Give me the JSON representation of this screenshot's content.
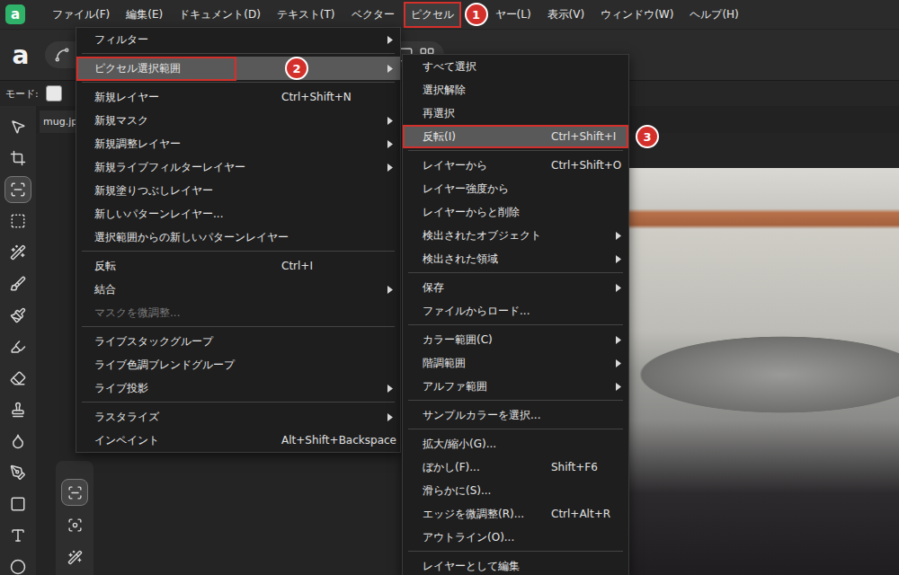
{
  "window": {
    "logo": "a"
  },
  "menubar": [
    {
      "label": "ファイル(F)",
      "selected": false,
      "annotated": false,
      "badge": ""
    },
    {
      "label": "編集(E)",
      "selected": false,
      "annotated": false,
      "badge": ""
    },
    {
      "label": "ドキュメント(D)",
      "selected": false,
      "annotated": false,
      "badge": ""
    },
    {
      "label": "テキスト(T)",
      "selected": false,
      "annotated": false,
      "badge": ""
    },
    {
      "label": "ベクター",
      "selected": false,
      "annotated": false,
      "badge": ""
    },
    {
      "label": "ピクセル",
      "selected": true,
      "annotated": true,
      "badge": "1"
    },
    {
      "label": "ヤー(L)",
      "selected": false,
      "annotated": false,
      "badge": ""
    },
    {
      "label": "表示(V)",
      "selected": false,
      "annotated": false,
      "badge": ""
    },
    {
      "label": "ウィンドウ(W)",
      "selected": false,
      "annotated": false,
      "badge": ""
    },
    {
      "label": "ヘルプ(H)",
      "selected": false,
      "annotated": false,
      "badge": ""
    }
  ],
  "mode_bar": {
    "label": "モード:",
    "checked": false
  },
  "document_tab": {
    "label": "mug.jp"
  },
  "tools": [
    {
      "selected": false
    },
    {
      "selected": false
    },
    {
      "selected": true
    },
    {
      "selected": false
    },
    {
      "selected": false
    },
    {
      "selected": false
    },
    {
      "selected": false
    },
    {
      "selected": false
    },
    {
      "selected": false
    },
    {
      "selected": false
    },
    {
      "selected": false
    },
    {
      "selected": false
    },
    {
      "selected": false
    },
    {
      "selected": false
    },
    {
      "selected": false
    }
  ],
  "floating_tools": [
    {
      "selected": true
    },
    {
      "selected": false
    },
    {
      "selected": false
    }
  ],
  "pixel_menu": [
    {
      "kind": "item",
      "label": "フィルター",
      "shortcut": "",
      "submenu": true,
      "selected": false,
      "disabled": false,
      "annotated": false,
      "badge": ""
    },
    {
      "kind": "separator"
    },
    {
      "kind": "item",
      "label": "ピクセル選択範囲",
      "shortcut": "",
      "submenu": true,
      "selected": true,
      "disabled": false,
      "annotated": true,
      "badge": "2"
    },
    {
      "kind": "separator"
    },
    {
      "kind": "item",
      "label": "新規レイヤー",
      "shortcut": "Ctrl+Shift+N",
      "submenu": false,
      "selected": false,
      "disabled": false,
      "annotated": false,
      "badge": ""
    },
    {
      "kind": "item",
      "label": "新規マスク",
      "shortcut": "",
      "submenu": true,
      "selected": false,
      "disabled": false,
      "annotated": false,
      "badge": ""
    },
    {
      "kind": "item",
      "label": "新規調整レイヤー",
      "shortcut": "",
      "submenu": true,
      "selected": false,
      "disabled": false,
      "annotated": false,
      "badge": ""
    },
    {
      "kind": "item",
      "label": "新規ライブフィルターレイヤー",
      "shortcut": "",
      "submenu": true,
      "selected": false,
      "disabled": false,
      "annotated": false,
      "badge": ""
    },
    {
      "kind": "item",
      "label": "新規塗りつぶしレイヤー",
      "shortcut": "",
      "submenu": false,
      "selected": false,
      "disabled": false,
      "annotated": false,
      "badge": ""
    },
    {
      "kind": "item",
      "label": "新しいパターンレイヤー...",
      "shortcut": "",
      "submenu": false,
      "selected": false,
      "disabled": false,
      "annotated": false,
      "badge": ""
    },
    {
      "kind": "item",
      "label": "選択範囲からの新しいパターンレイヤー",
      "shortcut": "",
      "submenu": false,
      "selected": false,
      "disabled": false,
      "annotated": false,
      "badge": ""
    },
    {
      "kind": "separator"
    },
    {
      "kind": "item",
      "label": "反転",
      "shortcut": "Ctrl+I",
      "submenu": false,
      "selected": false,
      "disabled": false,
      "annotated": false,
      "badge": ""
    },
    {
      "kind": "item",
      "label": "結合",
      "shortcut": "",
      "submenu": true,
      "selected": false,
      "disabled": false,
      "annotated": false,
      "badge": ""
    },
    {
      "kind": "item",
      "label": "マスクを微調整...",
      "shortcut": "",
      "submenu": false,
      "selected": false,
      "disabled": true,
      "annotated": false,
      "badge": ""
    },
    {
      "kind": "separator"
    },
    {
      "kind": "item",
      "label": "ライブスタックグループ",
      "shortcut": "",
      "submenu": false,
      "selected": false,
      "disabled": false,
      "annotated": false,
      "badge": ""
    },
    {
      "kind": "item",
      "label": "ライブ色調ブレンドグループ",
      "shortcut": "",
      "submenu": false,
      "selected": false,
      "disabled": false,
      "annotated": false,
      "badge": ""
    },
    {
      "kind": "item",
      "label": "ライブ投影",
      "shortcut": "",
      "submenu": true,
      "selected": false,
      "disabled": false,
      "annotated": false,
      "badge": ""
    },
    {
      "kind": "separator"
    },
    {
      "kind": "item",
      "label": "ラスタライズ",
      "shortcut": "",
      "submenu": true,
      "selected": false,
      "disabled": false,
      "annotated": false,
      "badge": ""
    },
    {
      "kind": "item",
      "label": "インペイント",
      "shortcut": "Alt+Shift+Backspace",
      "submenu": false,
      "selected": false,
      "disabled": false,
      "annotated": false,
      "badge": ""
    }
  ],
  "selection_submenu": [
    {
      "kind": "item",
      "label": "すべて選択",
      "shortcut": "",
      "submenu": false,
      "selected": false,
      "disabled": false,
      "annotated": false,
      "badge": ""
    },
    {
      "kind": "item",
      "label": "選択解除",
      "shortcut": "",
      "submenu": false,
      "selected": false,
      "disabled": false,
      "annotated": false,
      "badge": ""
    },
    {
      "kind": "item",
      "label": "再選択",
      "shortcut": "",
      "submenu": false,
      "selected": false,
      "disabled": false,
      "annotated": false,
      "badge": ""
    },
    {
      "kind": "item",
      "label": "反転(I)",
      "shortcut": "Ctrl+Shift+I",
      "submenu": false,
      "selected": true,
      "disabled": false,
      "annotated": true,
      "badge": "3"
    },
    {
      "kind": "separator"
    },
    {
      "kind": "item",
      "label": "レイヤーから",
      "shortcut": "Ctrl+Shift+O",
      "submenu": false,
      "selected": false,
      "disabled": false,
      "annotated": false,
      "badge": ""
    },
    {
      "kind": "item",
      "label": "レイヤー強度から",
      "shortcut": "",
      "submenu": false,
      "selected": false,
      "disabled": false,
      "annotated": false,
      "badge": ""
    },
    {
      "kind": "item",
      "label": "レイヤーからと削除",
      "shortcut": "",
      "submenu": false,
      "selected": false,
      "disabled": false,
      "annotated": false,
      "badge": ""
    },
    {
      "kind": "item",
      "label": "検出されたオブジェクト",
      "shortcut": "",
      "submenu": true,
      "selected": false,
      "disabled": false,
      "annotated": false,
      "badge": ""
    },
    {
      "kind": "item",
      "label": "検出された領域",
      "shortcut": "",
      "submenu": true,
      "selected": false,
      "disabled": false,
      "annotated": false,
      "badge": ""
    },
    {
      "kind": "separator"
    },
    {
      "kind": "item",
      "label": "保存",
      "shortcut": "",
      "submenu": true,
      "selected": false,
      "disabled": false,
      "annotated": false,
      "badge": ""
    },
    {
      "kind": "item",
      "label": "ファイルからロード...",
      "shortcut": "",
      "submenu": false,
      "selected": false,
      "disabled": false,
      "annotated": false,
      "badge": ""
    },
    {
      "kind": "separator"
    },
    {
      "kind": "item",
      "label": "カラー範囲(C)",
      "shortcut": "",
      "submenu": true,
      "selected": false,
      "disabled": false,
      "annotated": false,
      "badge": ""
    },
    {
      "kind": "item",
      "label": "階調範囲",
      "shortcut": "",
      "submenu": true,
      "selected": false,
      "disabled": false,
      "annotated": false,
      "badge": ""
    },
    {
      "kind": "item",
      "label": "アルファ範囲",
      "shortcut": "",
      "submenu": true,
      "selected": false,
      "disabled": false,
      "annotated": false,
      "badge": ""
    },
    {
      "kind": "separator"
    },
    {
      "kind": "item",
      "label": "サンプルカラーを選択...",
      "shortcut": "",
      "submenu": false,
      "selected": false,
      "disabled": false,
      "annotated": false,
      "badge": ""
    },
    {
      "kind": "separator"
    },
    {
      "kind": "item",
      "label": "拡大/縮小(G)...",
      "shortcut": "",
      "submenu": false,
      "selected": false,
      "disabled": false,
      "annotated": false,
      "badge": ""
    },
    {
      "kind": "item",
      "label": "ぼかし(F)...",
      "shortcut": "Shift+F6",
      "submenu": false,
      "selected": false,
      "disabled": false,
      "annotated": false,
      "badge": ""
    },
    {
      "kind": "item",
      "label": "滑らかに(S)...",
      "shortcut": "",
      "submenu": false,
      "selected": false,
      "disabled": false,
      "annotated": false,
      "badge": ""
    },
    {
      "kind": "item",
      "label": "エッジを微調整(R)...",
      "shortcut": "Ctrl+Alt+R",
      "submenu": false,
      "selected": false,
      "disabled": false,
      "annotated": false,
      "badge": ""
    },
    {
      "kind": "item",
      "label": "アウトライン(O)...",
      "shortcut": "",
      "submenu": false,
      "selected": false,
      "disabled": false,
      "annotated": false,
      "badge": ""
    },
    {
      "kind": "separator"
    },
    {
      "kind": "item",
      "label": "レイヤーとして編集",
      "shortcut": "",
      "submenu": false,
      "selected": false,
      "disabled": false,
      "annotated": false,
      "badge": ""
    }
  ]
}
